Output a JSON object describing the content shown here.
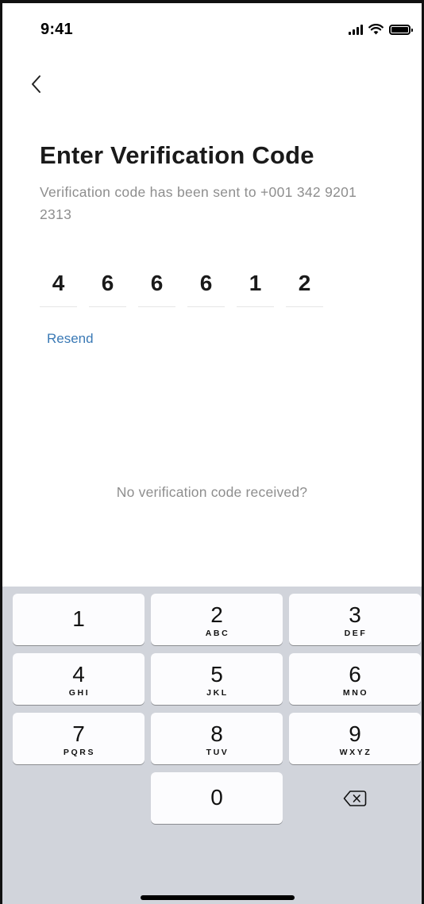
{
  "status_bar": {
    "time": "9:41"
  },
  "header": {
    "back_icon": "chevron-left-icon"
  },
  "main": {
    "title": "Enter Verification Code",
    "subtitle": "Verification code has been sent to +001 342 9201 2313",
    "code_digits": [
      "4",
      "6",
      "6",
      "6",
      "1",
      "2"
    ],
    "resend_label": "Resend",
    "no_code_text": "No verification code received?"
  },
  "keypad": {
    "keys": [
      {
        "number": "1",
        "letters": ""
      },
      {
        "number": "2",
        "letters": "ABC"
      },
      {
        "number": "3",
        "letters": "DEF"
      },
      {
        "number": "4",
        "letters": "GHI"
      },
      {
        "number": "5",
        "letters": "JKL"
      },
      {
        "number": "6",
        "letters": "MNO"
      },
      {
        "number": "7",
        "letters": "PQRS"
      },
      {
        "number": "8",
        "letters": "TUV"
      },
      {
        "number": "9",
        "letters": "WXYZ"
      },
      {
        "number": "0",
        "letters": ""
      }
    ],
    "delete_icon": "backspace-icon"
  },
  "colors": {
    "accent_link": "#3a79b5",
    "muted_text": "#8e8e8e",
    "keypad_background": "#d1d4db"
  }
}
